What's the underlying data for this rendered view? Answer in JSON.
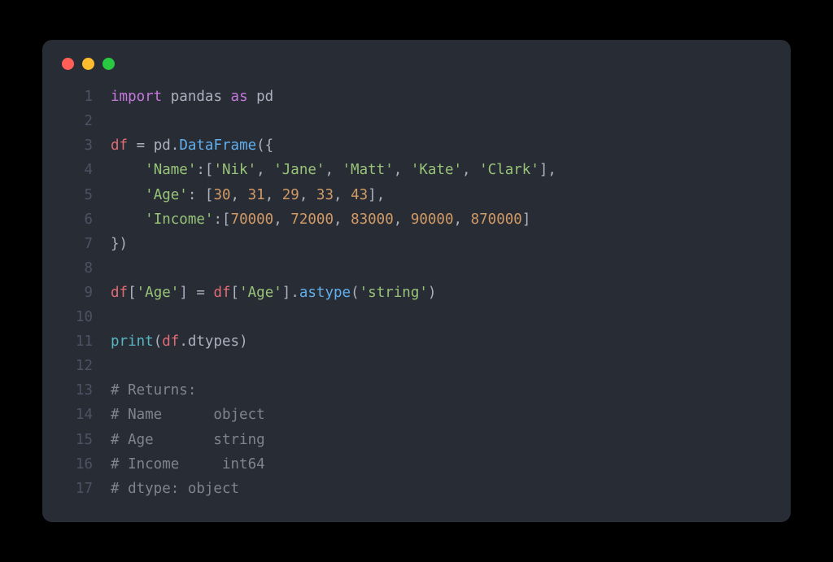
{
  "window": {
    "controls": [
      "close",
      "minimize",
      "zoom"
    ]
  },
  "colors": {
    "red": "#ff5f57",
    "yellow": "#febc2e",
    "green": "#28c840",
    "bg": "#282c34"
  },
  "code": {
    "lines": [
      {
        "n": "1",
        "tokens": [
          [
            "import ",
            "keyword"
          ],
          [
            "pandas ",
            "module"
          ],
          [
            "as ",
            "keyword"
          ],
          [
            "pd",
            "module"
          ]
        ]
      },
      {
        "n": "2",
        "tokens": []
      },
      {
        "n": "3",
        "tokens": [
          [
            "df ",
            "var"
          ],
          [
            "= ",
            "punct"
          ],
          [
            "pd",
            "module"
          ],
          [
            ".",
            "punct"
          ],
          [
            "DataFrame",
            "func"
          ],
          [
            "({",
            "punct"
          ]
        ]
      },
      {
        "n": "4",
        "tokens": [
          [
            "    ",
            "default"
          ],
          [
            "'Name'",
            "string"
          ],
          [
            ":[",
            "punct"
          ],
          [
            "'Nik'",
            "string"
          ],
          [
            ", ",
            "punct"
          ],
          [
            "'Jane'",
            "string"
          ],
          [
            ", ",
            "punct"
          ],
          [
            "'Matt'",
            "string"
          ],
          [
            ", ",
            "punct"
          ],
          [
            "'Kate'",
            "string"
          ],
          [
            ", ",
            "punct"
          ],
          [
            "'Clark'",
            "string"
          ],
          [
            "],",
            "punct"
          ]
        ]
      },
      {
        "n": "5",
        "tokens": [
          [
            "    ",
            "default"
          ],
          [
            "'Age'",
            "string"
          ],
          [
            ": [",
            "punct"
          ],
          [
            "30",
            "number"
          ],
          [
            ", ",
            "punct"
          ],
          [
            "31",
            "number"
          ],
          [
            ", ",
            "punct"
          ],
          [
            "29",
            "number"
          ],
          [
            ", ",
            "punct"
          ],
          [
            "33",
            "number"
          ],
          [
            ", ",
            "punct"
          ],
          [
            "43",
            "number"
          ],
          [
            "],",
            "punct"
          ]
        ]
      },
      {
        "n": "6",
        "tokens": [
          [
            "    ",
            "default"
          ],
          [
            "'Income'",
            "string"
          ],
          [
            ":[",
            "punct"
          ],
          [
            "70000",
            "number"
          ],
          [
            ", ",
            "punct"
          ],
          [
            "72000",
            "number"
          ],
          [
            ", ",
            "punct"
          ],
          [
            "83000",
            "number"
          ],
          [
            ", ",
            "punct"
          ],
          [
            "90000",
            "number"
          ],
          [
            ", ",
            "punct"
          ],
          [
            "870000",
            "number"
          ],
          [
            "]",
            "punct"
          ]
        ]
      },
      {
        "n": "7",
        "tokens": [
          [
            "})",
            "punct"
          ]
        ]
      },
      {
        "n": "8",
        "tokens": []
      },
      {
        "n": "9",
        "tokens": [
          [
            "df",
            "var"
          ],
          [
            "[",
            "punct"
          ],
          [
            "'Age'",
            "string"
          ],
          [
            "] = ",
            "punct"
          ],
          [
            "df",
            "var"
          ],
          [
            "[",
            "punct"
          ],
          [
            "'Age'",
            "string"
          ],
          [
            "].",
            "punct"
          ],
          [
            "astype",
            "func"
          ],
          [
            "(",
            "punct"
          ],
          [
            "'string'",
            "string"
          ],
          [
            ")",
            "punct"
          ]
        ]
      },
      {
        "n": "10",
        "tokens": []
      },
      {
        "n": "11",
        "tokens": [
          [
            "print",
            "builtin"
          ],
          [
            "(",
            "punct"
          ],
          [
            "df",
            "var"
          ],
          [
            ".",
            "punct"
          ],
          [
            "dtypes",
            "prop"
          ],
          [
            ")",
            "punct"
          ]
        ]
      },
      {
        "n": "12",
        "tokens": []
      },
      {
        "n": "13",
        "tokens": [
          [
            "# Returns:",
            "comment"
          ]
        ]
      },
      {
        "n": "14",
        "tokens": [
          [
            "# Name      object",
            "comment"
          ]
        ]
      },
      {
        "n": "15",
        "tokens": [
          [
            "# Age       string",
            "comment"
          ]
        ]
      },
      {
        "n": "16",
        "tokens": [
          [
            "# Income     int64",
            "comment"
          ]
        ]
      },
      {
        "n": "17",
        "tokens": [
          [
            "# dtype: object",
            "comment"
          ]
        ]
      }
    ]
  }
}
